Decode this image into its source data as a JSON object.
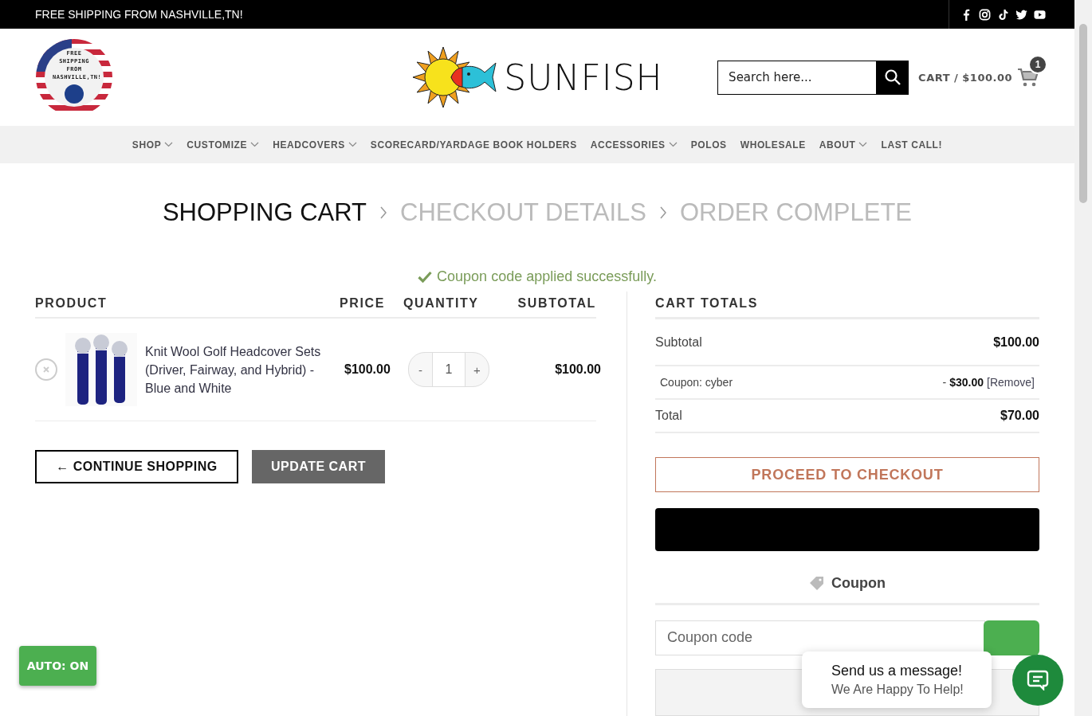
{
  "top_bar": {
    "text": "FREE SHIPPING FROM NASHVILLE,TN!"
  },
  "header": {
    "badge_text": "FREE SHIPPING FROM NASHVILLE,TN!",
    "logo_text": "SUNFISH",
    "search": {
      "placeholder": "Search here..."
    },
    "cart": {
      "label": "CART / $100.00",
      "count": "1"
    }
  },
  "nav": [
    {
      "label": "SHOP",
      "dropdown": true
    },
    {
      "label": "CUSTOMIZE",
      "dropdown": true
    },
    {
      "label": "HEADCOVERS",
      "dropdown": true
    },
    {
      "label": "SCORECARD/YARDAGE BOOK HOLDERS",
      "dropdown": false
    },
    {
      "label": "ACCESSORIES",
      "dropdown": true
    },
    {
      "label": "POLOS",
      "dropdown": false
    },
    {
      "label": "WHOLESALE",
      "dropdown": false
    },
    {
      "label": "ABOUT",
      "dropdown": true
    },
    {
      "label": "LAST CALL!",
      "dropdown": false
    }
  ],
  "steps": [
    {
      "label": "SHOPPING CART",
      "selected": true
    },
    {
      "label": "CHECKOUT DETAILS",
      "selected": false
    },
    {
      "label": "ORDER COMPLETE",
      "selected": false
    }
  ],
  "notice": "Coupon code applied successfully.",
  "table": {
    "columns": [
      "PRODUCT",
      "PRICE",
      "QUANTITY",
      "SUBTOTAL"
    ],
    "rows": [
      {
        "name": "Knit Wool Golf Headcover Sets (Driver, Fairway, and Hybrid) - Blue and White",
        "price": "$100.00",
        "minus": "-",
        "quantity": "1",
        "plus": "+",
        "subtotal": "$100.00"
      }
    ]
  },
  "buttons": {
    "continue": "← CONTINUE SHOPPING",
    "update": "UPDATE CART"
  },
  "totals": {
    "title": "CART TOTALS",
    "subtotal_label": "Subtotal",
    "subtotal": "$100.00",
    "coupon_label": "Coupon: cyber",
    "coupon_amount_prefix": "-",
    "coupon_amount": "$30.00",
    "remove": "[Remove]",
    "total_label": "Total",
    "total": "$70.00",
    "checkout": "PROCEED TO CHECKOUT",
    "coupon_heading": "Coupon",
    "coupon_placeholder": "Coupon code"
  },
  "auto_button": "AUTO: ON",
  "chat": {
    "title": "Send us a message!",
    "subtitle": "We Are Happy To Help!"
  }
}
